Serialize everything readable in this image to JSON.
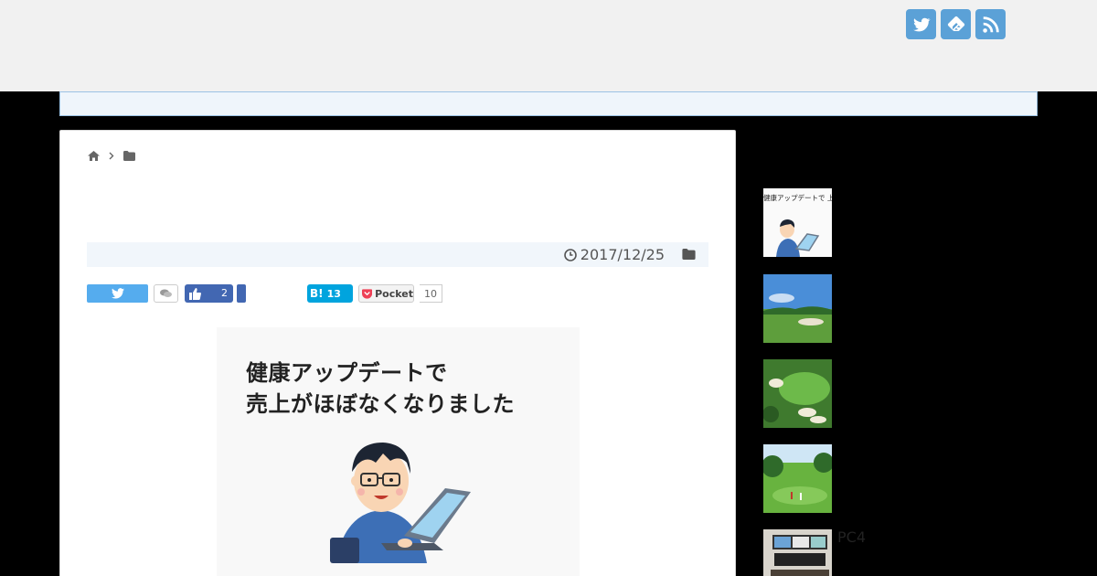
{
  "header": {
    "social": [
      {
        "name": "twitter-icon"
      },
      {
        "name": "feedly-icon"
      },
      {
        "name": "rss-icon"
      }
    ]
  },
  "article": {
    "date": "2017/12/25",
    "share": {
      "facebook_count": "2",
      "hatena_label": "B!",
      "hatena_count": "13",
      "pocket_label": "Pocket",
      "pocket_count": "10"
    },
    "eyecatch": {
      "line1": "健康アップデートで",
      "line2": "売上がほぼなくなりました"
    }
  },
  "sidebar": {
    "thumb_caption": "健康アップデートで 上がほぼなくなりまし",
    "items": [
      {
        "label": ""
      },
      {
        "label": ""
      },
      {
        "label": ""
      },
      {
        "label": ""
      },
      {
        "label": "PC4"
      }
    ]
  },
  "colors": {
    "accent": "#5ba1d7",
    "twitter": "#55acee",
    "facebook": "#4267b2",
    "hatena": "#00a4de",
    "pocket": "#ee4056"
  }
}
